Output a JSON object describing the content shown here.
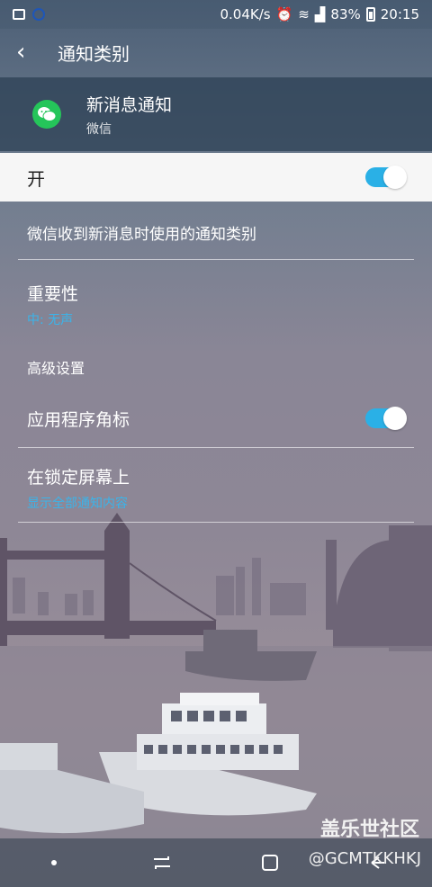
{
  "status_bar": {
    "speed": "0.04K/s",
    "battery": "83%",
    "time": "20:15"
  },
  "header": {
    "title": "通知类别"
  },
  "app": {
    "name": "新消息通知",
    "subtitle": "微信"
  },
  "master_toggle": {
    "label": "开",
    "on": true
  },
  "description": "微信收到新消息时使用的通知类别",
  "importance": {
    "title": "重要性",
    "value": "中: 无声"
  },
  "advanced": {
    "title": "高级设置"
  },
  "app_badge": {
    "title": "应用程序角标",
    "on": true
  },
  "lock_screen": {
    "title": "在锁定屏幕上",
    "value": "显示全部通知内容"
  },
  "watermark": {
    "line1": "盖乐世社区",
    "line2": "@GCMTKKHKJ"
  },
  "colors": {
    "accent": "#2ab0e6",
    "wechat": "#25c55a"
  }
}
